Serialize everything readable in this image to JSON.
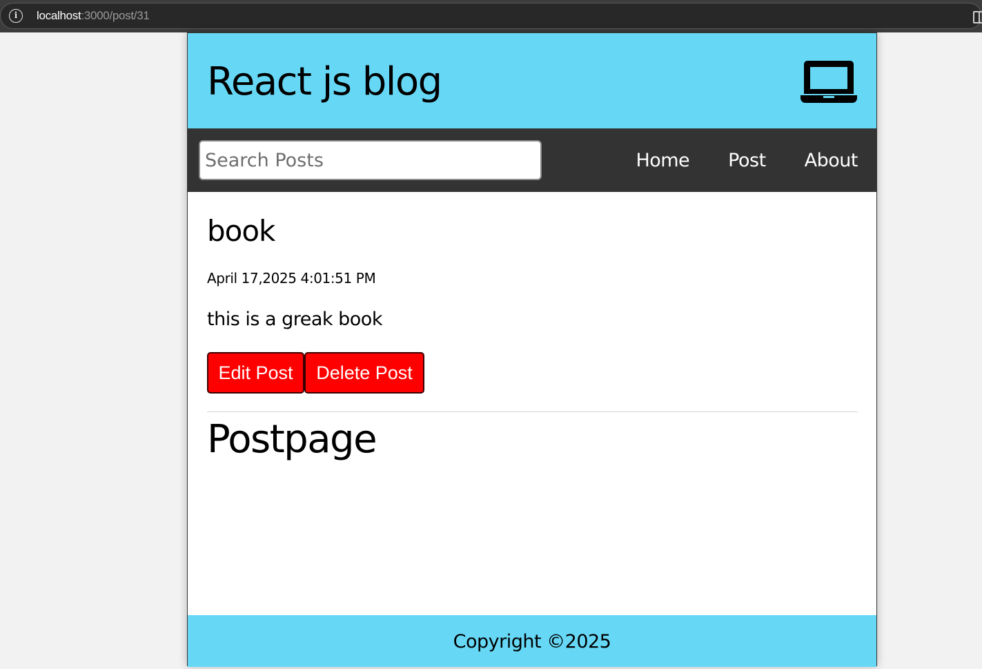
{
  "browser": {
    "url_host": "localhost",
    "url_path": ":3000/post/31",
    "info_icon": "info-icon",
    "split_icon": "split-screen-icon"
  },
  "header": {
    "title": "React js blog",
    "icon": "laptop-icon",
    "background": "#66d8f5"
  },
  "nav": {
    "search_placeholder": "Search Posts",
    "search_value": "",
    "links": [
      "Home",
      "Post",
      "About"
    ],
    "background": "#333333"
  },
  "post": {
    "title": "book",
    "datetime": "April 17,2025 4:01:51 PM",
    "body": "this is a greak book",
    "edit_label": "Edit Post",
    "delete_label": "Delete Post",
    "button_color": "#ff0000"
  },
  "page": {
    "heading": "Postpage"
  },
  "footer": {
    "text": "Copyright ©2025"
  }
}
